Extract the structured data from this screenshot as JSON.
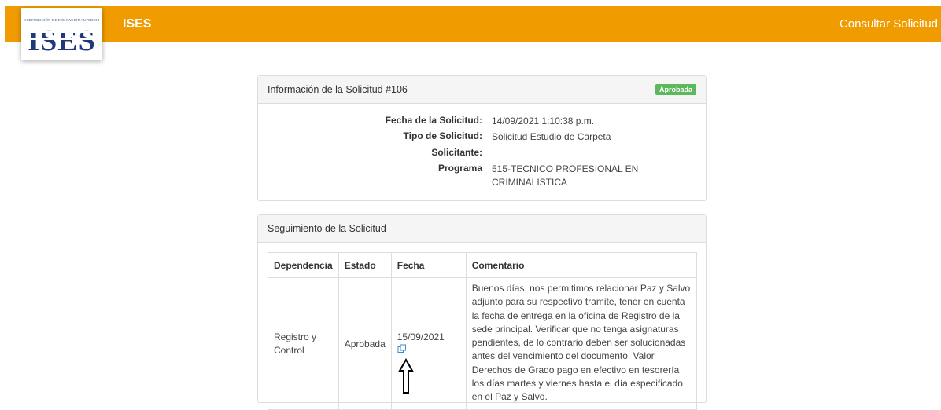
{
  "header": {
    "logo_caption": "CORPORACIÓN DE EDUCACIÓN SUPERIOR",
    "logo_text": "ISES",
    "app_title": "ISES",
    "nav_link": "Consultar Solicitud"
  },
  "request_info": {
    "title": "Información de la Solicitud #106",
    "status_badge": "Aprobada",
    "fields": [
      {
        "label": "Fecha de la Solicitud:",
        "value": "14/09/2021 1:10:38 p.m."
      },
      {
        "label": "Tipo de Solicitud:",
        "value": "Solicitud Estudio de Carpeta"
      },
      {
        "label": "Solicitante:",
        "value": ""
      },
      {
        "label": "Programa",
        "value": "515-TECNICO PROFESIONAL EN CRIMINALISTICA"
      }
    ]
  },
  "tracking": {
    "title": "Seguimiento de la Solicitud",
    "columns": [
      "Dependencia",
      "Estado",
      "Fecha",
      "Comentario"
    ],
    "rows": [
      {
        "dependencia": "Registro y Control",
        "estado": "Aprobada",
        "fecha": "15/09/2021",
        "comentario": "Buenos días, nos permitimos relacionar Paz y Salvo adjunto para su respectivo tramite, tener en cuenta la fecha de entrega en la oficina de Registro de la sede principal. Verificar que no tenga asignaturas pendientes, de lo contrario deben ser solucionadas antes del vencimiento del documento. Valor Derechos de Grado                pago en efectivo en tesorería los días martes y viernes hasta el día especificado en el Paz y Salvo."
      }
    ]
  },
  "icons": {
    "attachment": "copy-document-icon",
    "annotation": "up-arrow-icon"
  },
  "colors": {
    "header_bg": "#f09b00",
    "badge_bg": "#5cb85c",
    "logo_blue": "#1f3a78",
    "link_blue": "#3a8ccf"
  }
}
